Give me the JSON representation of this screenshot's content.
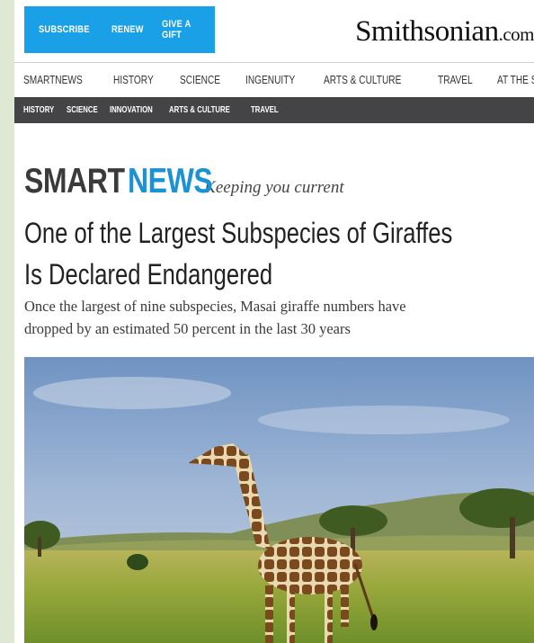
{
  "top_bar": {
    "subscribe": "SUBSCRIBE",
    "renew": "RENEW",
    "give_gift": "GIVE A GIFT",
    "logo_main": "Smithsonian",
    "logo_suffix": ".com",
    "accent_color": "#1aa0e6"
  },
  "main_nav": [
    "SMARTNEWS",
    "HISTORY",
    "SCIENCE",
    "INGENUITY",
    "ARTS & CULTURE",
    "TRAVEL",
    "AT THE SMITHSONIAN"
  ],
  "sub_nav": [
    "HISTORY",
    "SCIENCE",
    "INNOVATION",
    "ARTS & CULTURE",
    "TRAVEL"
  ],
  "section": {
    "smart": "SMART",
    "news": "NEWS",
    "tagline": "Keeping you current",
    "news_color": "#1a92d6"
  },
  "article": {
    "headline_line1": "One of the Largest Subspecies of Giraffes",
    "headline_line2": "Is Declared Endangered",
    "subtitle_line1": "Once the largest of nine subspecies, Masai giraffe numbers have",
    "subtitle_line2": "dropped by an estimated 50 percent in the last 30 years"
  }
}
